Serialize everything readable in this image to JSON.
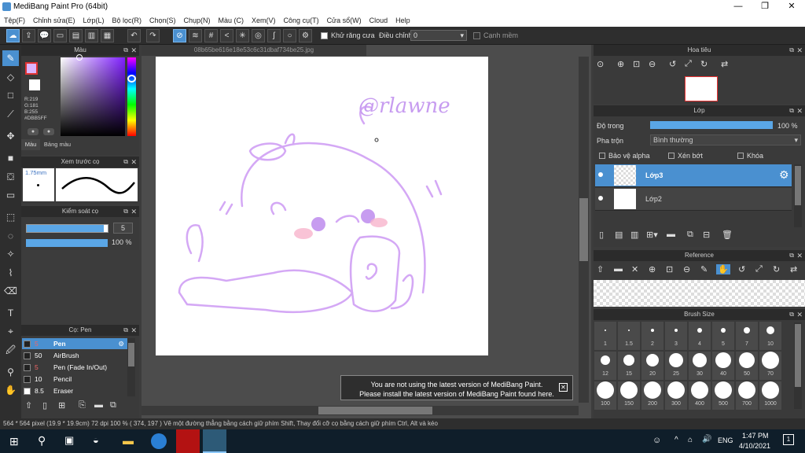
{
  "window": {
    "title": "MediBang Paint Pro (64bit)",
    "min": "—",
    "max": "❐",
    "close": "✕"
  },
  "menu": [
    "Tệp(F)",
    "Chỉnh sửa(E)",
    "Lớp(L)",
    "Bộ lọc(R)",
    "Chọn(S)",
    "Chụp(N)",
    "Màu (C)",
    "Xem(V)",
    "Công cụ(T)",
    "Cửa sổ(W)",
    "Cloud",
    "Help"
  ],
  "toolbar": {
    "antialias_label": "Khử răng cưa",
    "adjust_label": "Điều chỉnh",
    "adjust_value": "0",
    "smooth_label": "Cạnh mềm"
  },
  "color_panel": {
    "title": "Màu",
    "r": "R:219",
    "g": "G:181",
    "b": "B:255",
    "hex": "#DBB5FF",
    "tab1": "Màu",
    "tab2": "Bảng màu",
    "fg": "#dbb5ff"
  },
  "preview_panel": {
    "title": "Xem trước cọ",
    "size": "1.75mm"
  },
  "control_panel": {
    "title": "Kiểm soát cọ",
    "size": "5",
    "opacity": "100 %",
    "size_fraction": 0.95,
    "opacity_fraction": 1.0
  },
  "brush_panel": {
    "title": "Cọ: Pen",
    "items": [
      {
        "num": "5",
        "name": "Pen"
      },
      {
        "num": "50",
        "name": "AirBrush"
      },
      {
        "num": "5",
        "name": "Pen (Fade In/Out)"
      },
      {
        "num": "10",
        "name": "Pencil"
      },
      {
        "num": "8.5",
        "name": "Eraser"
      }
    ]
  },
  "canvas": {
    "tab": "08b65be616e18e53c6c31dbaf734be25.jpg",
    "signature": "@rlawne"
  },
  "notice": {
    "line1": "You are not using the latest version of MediBang Paint.",
    "line2": "Please install the latest version of MediBang Paint found here."
  },
  "navigator": {
    "title": "Hoa tiêu"
  },
  "layer_panel": {
    "title": "Lớp",
    "opacity_label": "Độ trong",
    "opacity_value": "100 %",
    "opacity_fraction": 1.0,
    "blend_label": "Pha trộn",
    "blend_value": "Bình thường",
    "protect_alpha": "Bảo vệ alpha",
    "clipping": "Xén bớt",
    "lock": "Khóa",
    "layers": [
      "Lớp3",
      "Lớp2"
    ]
  },
  "reference": {
    "title": "Reference"
  },
  "brush_size": {
    "title": "Brush Size",
    "row1": [
      "1",
      "1.5",
      "2",
      "3",
      "4",
      "5",
      "7",
      "10"
    ],
    "row2": [
      "12",
      "15",
      "20",
      "25",
      "30",
      "40",
      "50",
      "70"
    ],
    "row3": [
      "100",
      "150",
      "200",
      "300",
      "400",
      "500",
      "700",
      "1000"
    ]
  },
  "status": {
    "text": "564 * 564 pixel   (19.9 * 19.9cm)   72 dpi   100 %   ( 374, 197 )   Vẽ một đường thẳng bằng cách giữ phím Shift, Thay đổi cỡ cọ bằng cách giữ phím Ctrl, Alt và kéo"
  },
  "taskbar": {
    "time": "1:47 PM",
    "date": "4/10/2021",
    "lang": "ENG",
    "notif": "1"
  }
}
